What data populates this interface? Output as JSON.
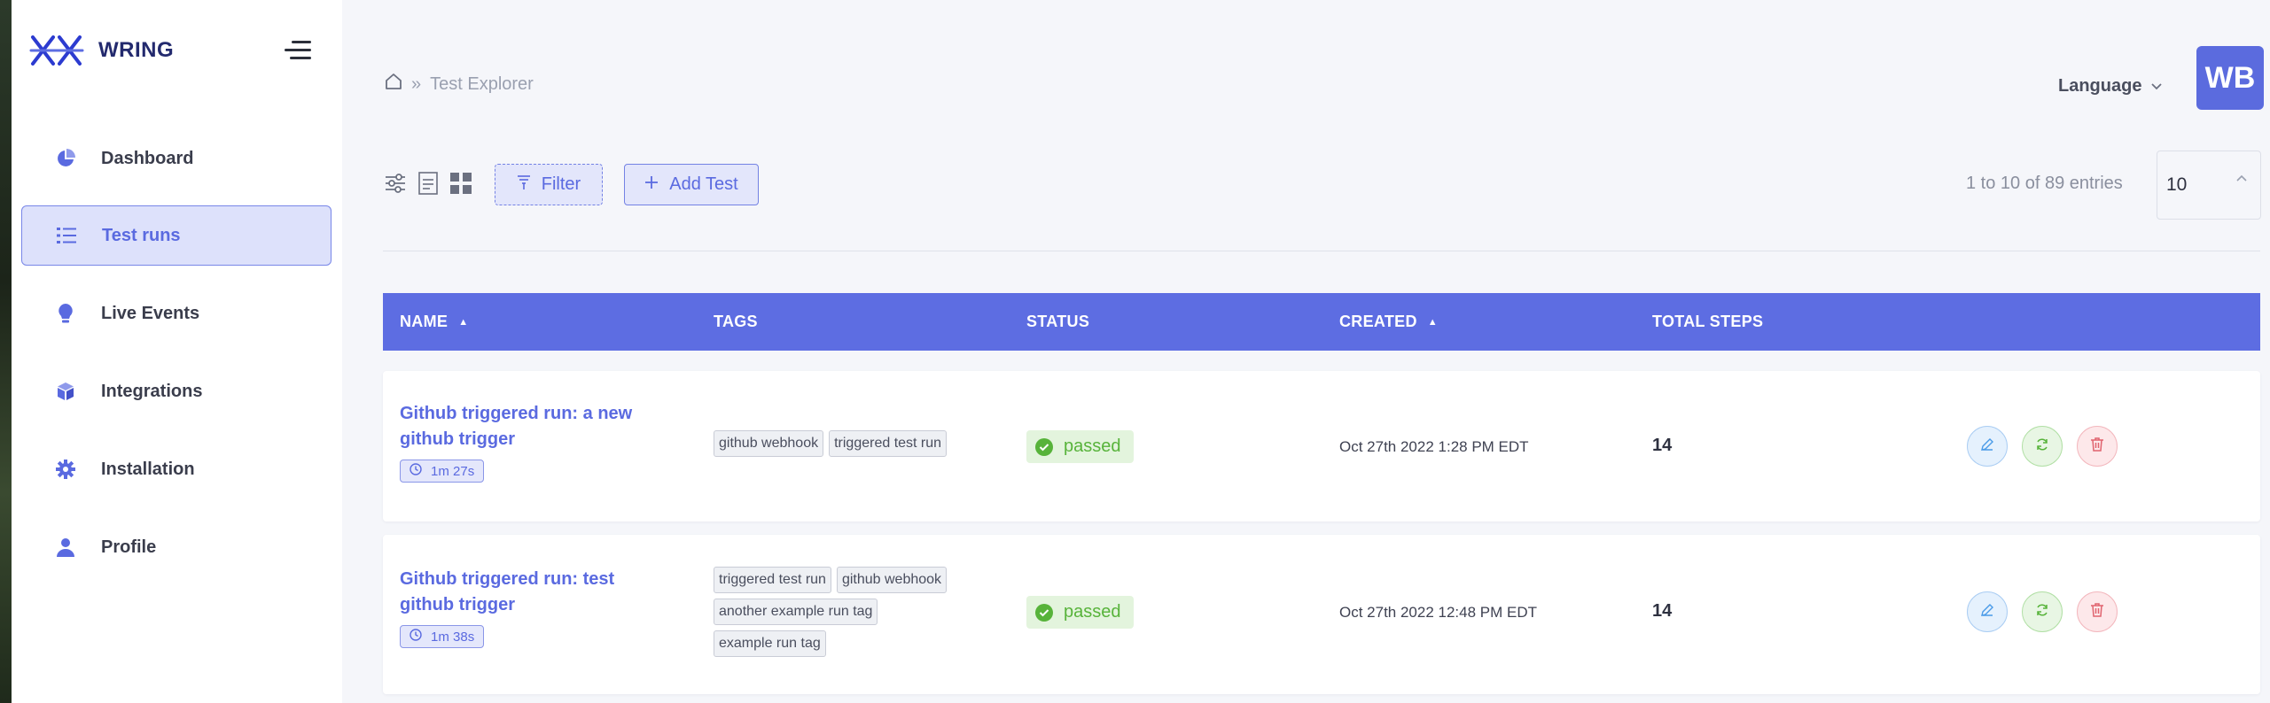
{
  "app": {
    "logo_text": "WRING",
    "colors": {
      "accent": "#5d6de2",
      "sidebar_bg": "#ffffff",
      "page_bg": "#f5f6fa",
      "status_passed": "#57b33a"
    }
  },
  "sidebar": {
    "items": [
      {
        "label": "Dashboard",
        "icon": "pie-chart-icon",
        "active": false
      },
      {
        "label": "Test runs",
        "icon": "list-icon",
        "active": true
      },
      {
        "label": "Live Events",
        "icon": "bulb-icon",
        "active": false
      },
      {
        "label": "Integrations",
        "icon": "cube-icon",
        "active": false
      },
      {
        "label": "Installation",
        "icon": "gear-icon",
        "active": false
      },
      {
        "label": "Profile",
        "icon": "user-icon",
        "active": false
      }
    ]
  },
  "header": {
    "breadcrumb_sep": "»",
    "breadcrumb_current": "Test Explorer",
    "language_label": "Language",
    "avatar_initials": "WB"
  },
  "toolbar": {
    "filter_label": "Filter",
    "add_test_label": "Add Test",
    "entries_text": "1 to 10 of 89 entries",
    "page_size": "10"
  },
  "table": {
    "columns": {
      "name": "NAME",
      "tags": "TAGS",
      "status": "STATUS",
      "created": "CREATED",
      "total_steps": "TOTAL STEPS"
    },
    "rows": [
      {
        "name": "Github triggered run: a new github trigger",
        "duration": "1m 27s",
        "tags": [
          "github webhook",
          "triggered test run"
        ],
        "status": "passed",
        "created": "Oct 27th 2022 1:28 PM EDT",
        "total_steps": "14"
      },
      {
        "name": "Github triggered run: test github trigger",
        "duration": "1m 38s",
        "tags": [
          "triggered test run",
          "github webhook",
          "another example run tag",
          "example run tag"
        ],
        "status": "passed",
        "created": "Oct 27th 2022 12:48 PM EDT",
        "total_steps": "14"
      }
    ]
  }
}
